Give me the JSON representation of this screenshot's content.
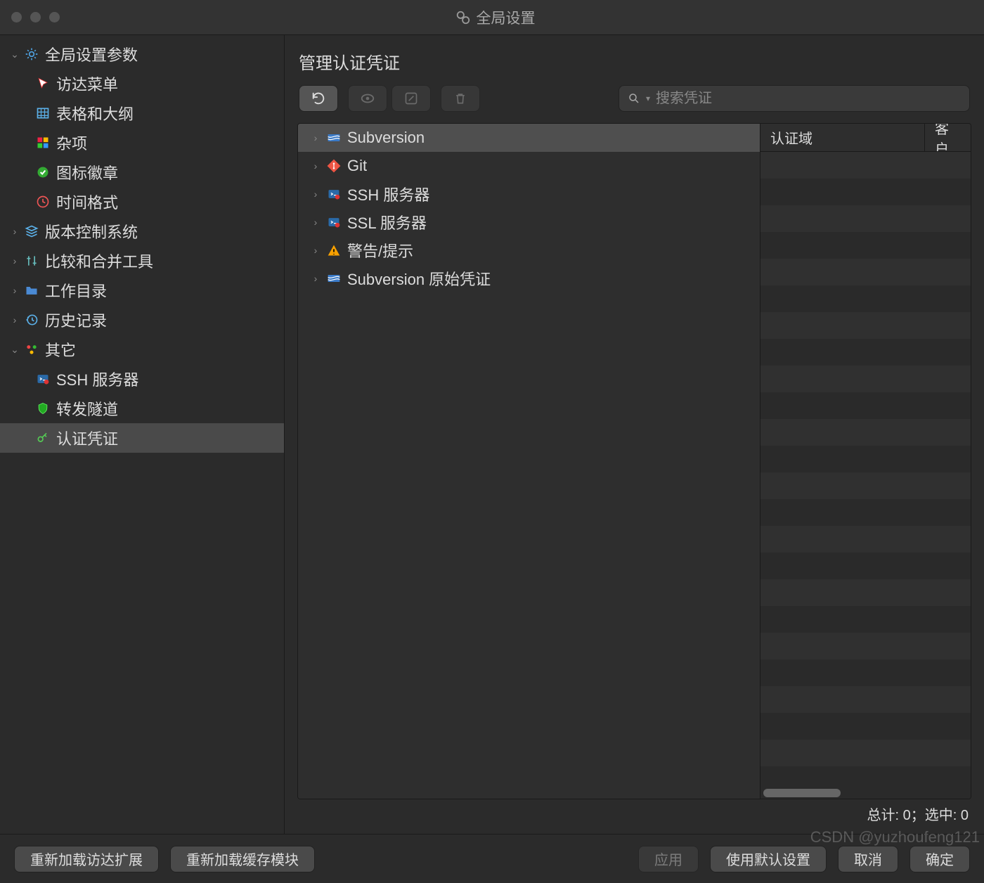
{
  "window": {
    "title": "全局设置"
  },
  "sidebar": {
    "sections": [
      {
        "label": "全局设置参数",
        "icon": "gear",
        "expanded": true,
        "children": [
          {
            "label": "访达菜单",
            "icon": "cursor"
          },
          {
            "label": "表格和大纲",
            "icon": "table"
          },
          {
            "label": "杂项",
            "icon": "blocks"
          },
          {
            "label": "图标徽章",
            "icon": "check-badge"
          },
          {
            "label": "时间格式",
            "icon": "clock"
          }
        ]
      },
      {
        "label": "版本控制系统",
        "icon": "stack",
        "expanded": false
      },
      {
        "label": "比较和合并工具",
        "icon": "compare",
        "expanded": false
      },
      {
        "label": "工作目录",
        "icon": "folder",
        "expanded": false
      },
      {
        "label": "历史记录",
        "icon": "history",
        "expanded": false
      },
      {
        "label": "其它",
        "icon": "dots",
        "expanded": true,
        "children": [
          {
            "label": "SSH 服务器",
            "icon": "terminal"
          },
          {
            "label": "转发隧道",
            "icon": "shield"
          },
          {
            "label": "认证凭证",
            "icon": "key",
            "selected": true
          }
        ]
      }
    ]
  },
  "main": {
    "heading": "管理认证凭证",
    "search_placeholder": "搜索凭证",
    "categories": [
      {
        "label": "Subversion",
        "icon": "svn",
        "selected": true
      },
      {
        "label": "Git",
        "icon": "git"
      },
      {
        "label": "SSH 服务器",
        "icon": "terminal"
      },
      {
        "label": "SSL 服务器",
        "icon": "terminal"
      },
      {
        "label": "警告/提示",
        "icon": "warning"
      },
      {
        "label": "Subversion 原始凭证",
        "icon": "svn"
      }
    ],
    "table": {
      "columns": [
        "认证域",
        "客户"
      ]
    },
    "status": "总计: 0；选中: 0"
  },
  "footer": {
    "reload_finder": "重新加载访达扩展",
    "reload_cache": "重新加载缓存模块",
    "apply": "应用",
    "defaults": "使用默认设置",
    "cancel": "取消",
    "ok": "确定"
  },
  "watermark": "CSDN @yuzhoufeng121"
}
